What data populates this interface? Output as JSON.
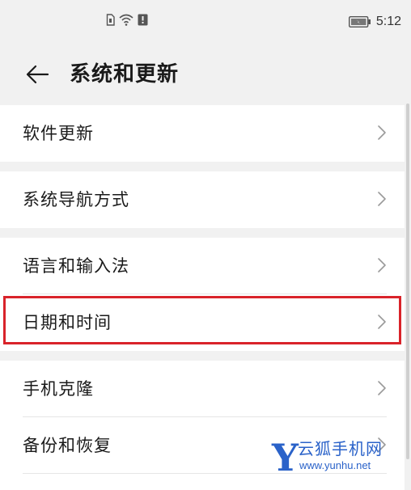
{
  "status_bar": {
    "time": "5:12",
    "icons": [
      "sim-icon",
      "wifi-icon",
      "notification-icon",
      "battery-icon"
    ]
  },
  "header": {
    "title": "系统和更新",
    "back_icon": "arrow-left-icon"
  },
  "groups": [
    {
      "items": [
        {
          "label": "软件更新"
        }
      ]
    },
    {
      "items": [
        {
          "label": "系统导航方式"
        }
      ]
    },
    {
      "items": [
        {
          "label": "语言和输入法"
        },
        {
          "label": "日期和时间",
          "highlighted": true
        }
      ]
    },
    {
      "items": [
        {
          "label": "手机克隆"
        },
        {
          "label": "备份和恢复"
        }
      ]
    }
  ],
  "watermark": {
    "letter": "Y",
    "name": "云狐手机网",
    "url": "www.yunhu.net"
  },
  "colors": {
    "background": "#f1f1f1",
    "card": "#ffffff",
    "highlight": "#d9232a",
    "watermark": "#2a62c9"
  }
}
